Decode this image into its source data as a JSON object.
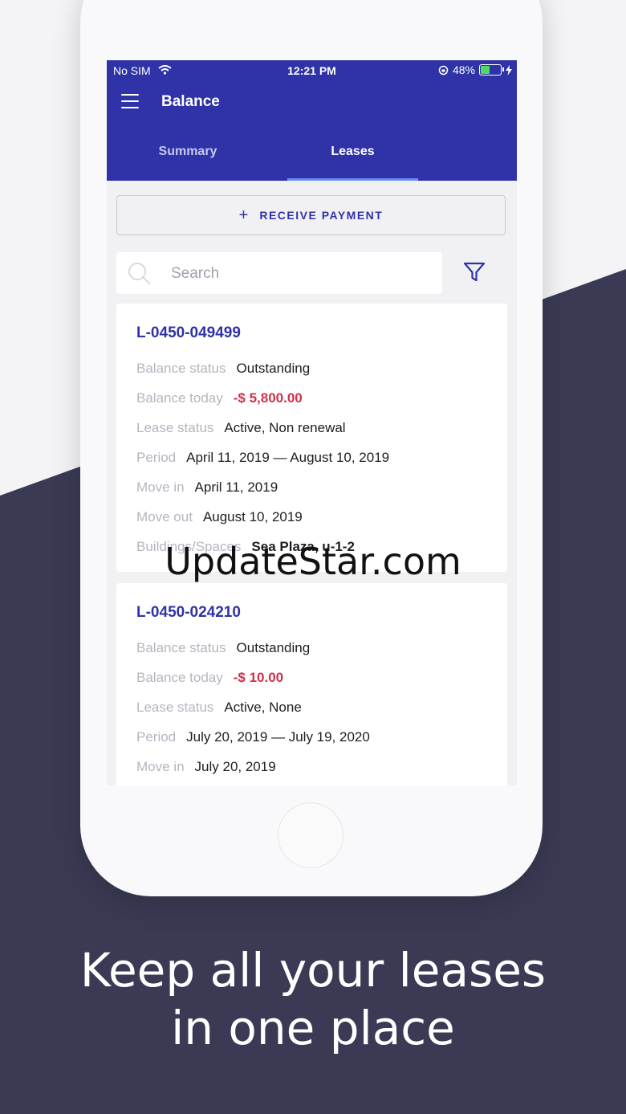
{
  "status_bar": {
    "carrier": "No SIM",
    "time": "12:21 PM",
    "battery": "48%",
    "battery_level": 0.48
  },
  "header": {
    "title": "Balance"
  },
  "tabs": [
    {
      "label": "Summary"
    },
    {
      "label": "Leases"
    }
  ],
  "receive_payment": {
    "label": "RECEIVE PAYMENT"
  },
  "search": {
    "placeholder": "Search"
  },
  "leases": [
    {
      "id": "L-0450-049499",
      "rows": [
        {
          "label": "Balance status",
          "value": "Outstanding"
        },
        {
          "label": "Balance today",
          "value": "-$ 5,800.00"
        },
        {
          "label": "Lease status",
          "value": "Active, Non renewal"
        },
        {
          "label": "Period",
          "value": "April 11, 2019 — August 10, 2019"
        },
        {
          "label": "Move in",
          "value": "April 11, 2019"
        },
        {
          "label": "Move out",
          "value": "August 10, 2019"
        },
        {
          "label": "Buildings/Spaces",
          "value": "Sea Plaza, u-1-2"
        }
      ]
    },
    {
      "id": "L-0450-024210",
      "rows": [
        {
          "label": "Balance status",
          "value": "Outstanding"
        },
        {
          "label": "Balance today",
          "value": "-$ 10.00"
        },
        {
          "label": "Lease status",
          "value": "Active, None"
        },
        {
          "label": "Period",
          "value": "July 20, 2019 — July 19, 2020"
        },
        {
          "label": "Move in",
          "value": "July 20, 2019"
        }
      ]
    }
  ],
  "watermark": "UpdateStar.com",
  "caption": {
    "line1": "Keep all your leases",
    "line2": "in one place"
  },
  "colors": {
    "primary": "#2f33a7",
    "negative": "#d0314a",
    "background_dark": "#3a3a55"
  }
}
